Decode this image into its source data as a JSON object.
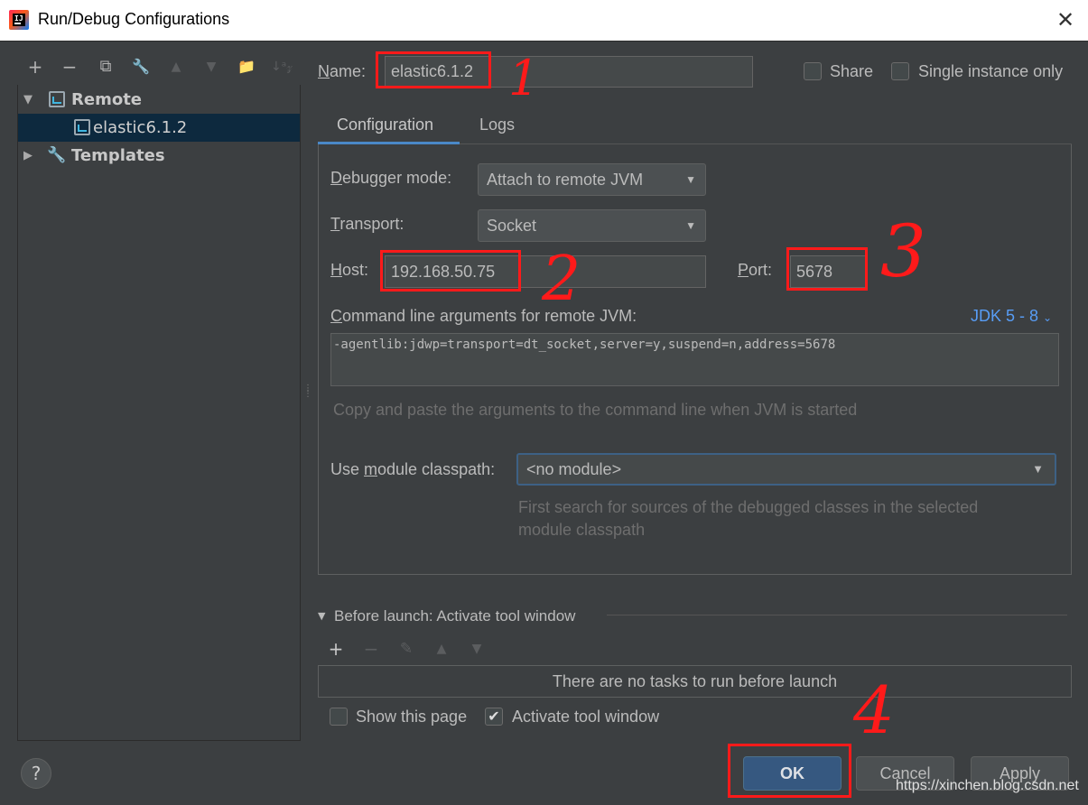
{
  "window": {
    "title": "Run/Debug Configurations",
    "close_glyph": "✕"
  },
  "toolbar": {
    "add": "+",
    "remove": "−",
    "copy": "⧉",
    "edit": "🔧",
    "up": "▲",
    "down": "▼",
    "folder": "📁",
    "sort": "↓ᵃ𝓏"
  },
  "tree": {
    "remote_label": "Remote",
    "remote_child": "elastic6.1.2",
    "templates_label": "Templates"
  },
  "form": {
    "name_label": "Name:",
    "name_value": "elastic6.1.2",
    "share_label": "Share",
    "single_instance_label": "Single instance only",
    "tabs": [
      "Configuration",
      "Logs"
    ],
    "debugger_mode_label": "Debugger mode:",
    "debugger_mode_value": "Attach to remote JVM",
    "transport_label": "Transport:",
    "transport_value": "Socket",
    "host_label": "Host:",
    "host_value": "192.168.50.75",
    "port_label": "Port:",
    "port_value": "5678",
    "cmd_label": "Command line arguments for remote JVM:",
    "jdk_label": "JDK 5 - 8",
    "cmd_value": "-agentlib:jdwp=transport=dt_socket,server=y,suspend=n,address=5678",
    "cmd_hint": "Copy and paste the arguments to the command line when JVM is started",
    "module_label": "Use module classpath:",
    "module_value": "<no module>",
    "module_hint_1": "First search for sources of the debugged classes in the selected",
    "module_hint_2": "module classpath"
  },
  "before_launch": {
    "title": "Before launch: Activate tool window",
    "empty_text": "There are no tasks to run before launch",
    "show_page_label": "Show this page",
    "activate_tool_label": "Activate tool window",
    "activate_tool_checked": true
  },
  "buttons": {
    "help": "?",
    "ok": "OK",
    "cancel": "Cancel",
    "apply": "Apply"
  },
  "annotations": {
    "n1": "1",
    "n2": "2",
    "n3": "3",
    "n4": "4",
    "color": "#ff1a1a"
  },
  "watermark": "https://xinchen.blog.csdn.net"
}
